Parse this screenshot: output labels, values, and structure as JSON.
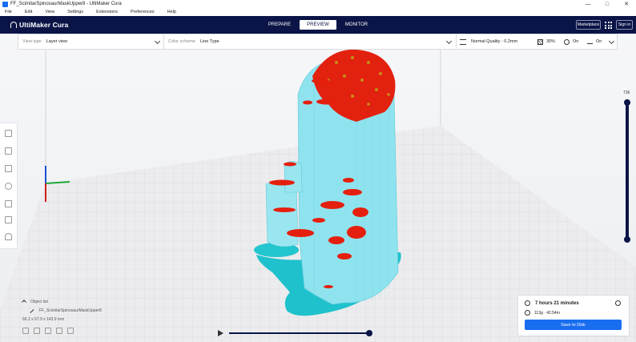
{
  "window": {
    "title": "FF_ScimitarSpinosaurMaskUpper8 - UltiMaker Cura",
    "controls": [
      "—",
      "□",
      "✕"
    ]
  },
  "menu": [
    "File",
    "Edit",
    "View",
    "Settings",
    "Extensions",
    "Preferences",
    "Help"
  ],
  "header": {
    "logo": "UltiMaker Cura",
    "stages": [
      "PREPARE",
      "PREVIEW",
      "MONITOR"
    ],
    "active_stage": "PREVIEW",
    "marketplace": "Marketplace",
    "sign_in": "Sign in"
  },
  "view_bar": {
    "view_type_label": "View type",
    "view_type_value": "Layer view",
    "color_scheme_label": "Color scheme",
    "color_scheme_value": "Line Type",
    "quality": "Normal Quality - 0.2mm",
    "infill": "30%",
    "support": "On",
    "adhesion": "On"
  },
  "layer_slider": {
    "max_layer": "716"
  },
  "object_info": {
    "object_list_label": "Object list",
    "object_name": "FF_ScimitarSpinosaurMaskUpper8",
    "dimensions": "66.2 x 67.9 x 143.9 mm"
  },
  "job": {
    "print_time": "7 hours 21 minutes",
    "material": "113g · 42.54m",
    "save_button": "Save to Disk"
  },
  "colors": {
    "header_bg": "#0a1446",
    "accent": "#196ef0",
    "support": "#8fe3ee",
    "wall": "#ee1c0b"
  }
}
